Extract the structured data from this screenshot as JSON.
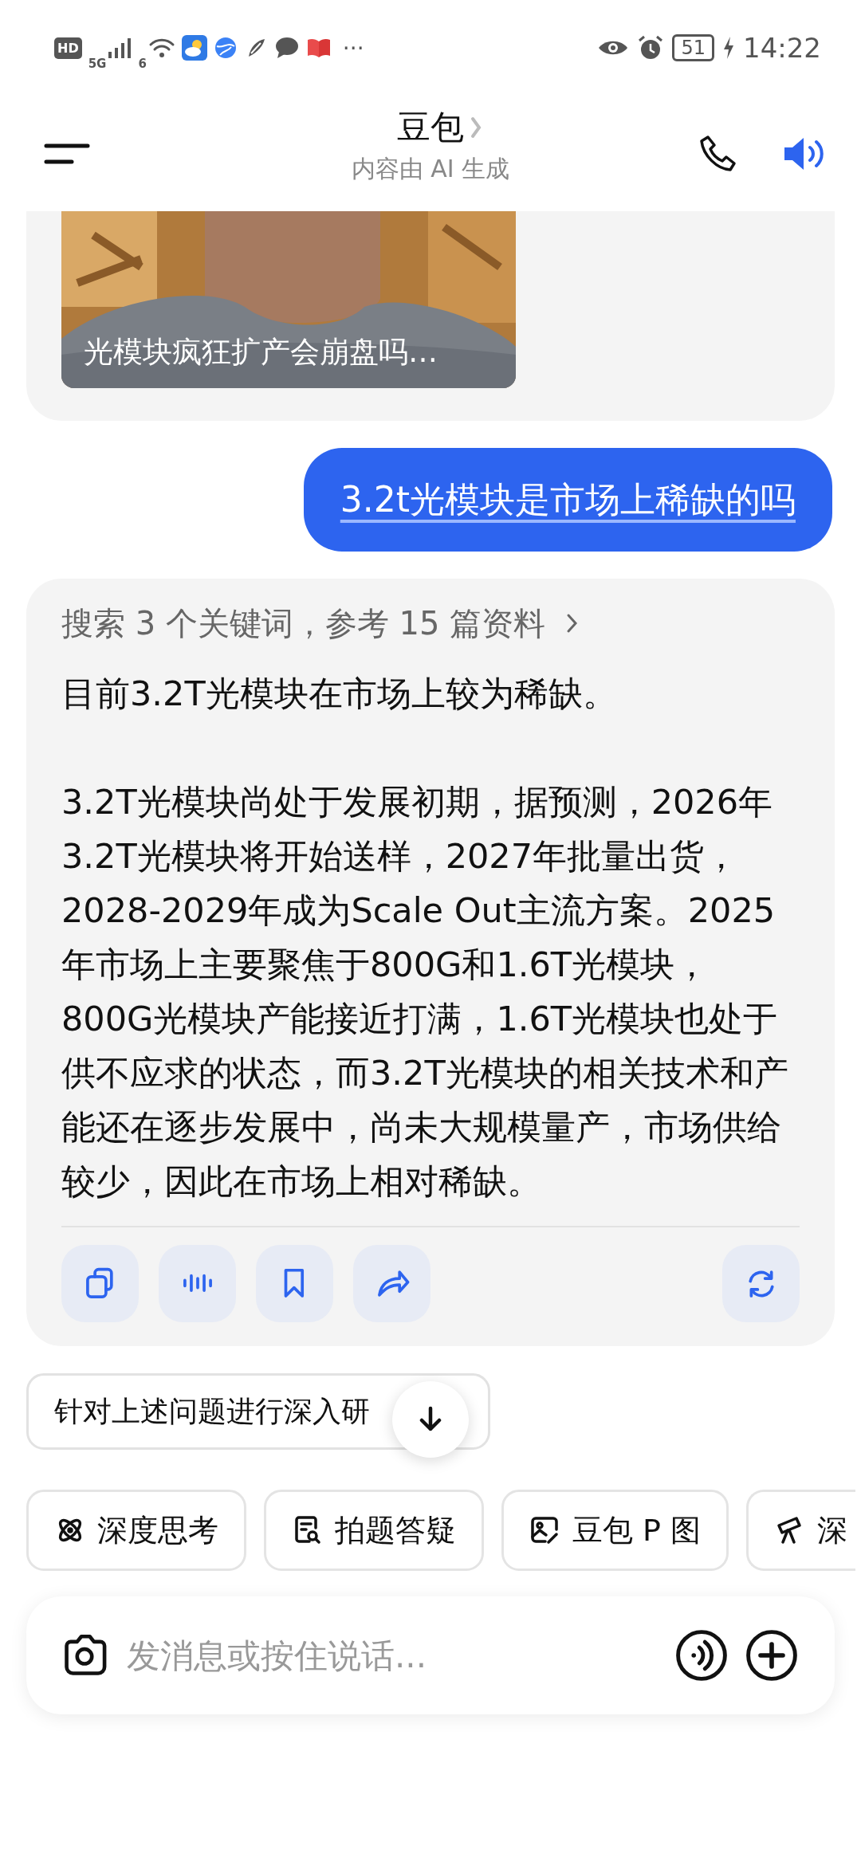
{
  "status_bar": {
    "hd": "HD",
    "network": "5G",
    "wifi": "6",
    "more": "···",
    "battery": "51",
    "time": "14:22"
  },
  "header": {
    "title": "豆包",
    "subtitle": "内容由 AI 生成"
  },
  "messages": [
    {
      "kind": "video_card",
      "caption": "光模块疯狂扩产会崩盘吗…"
    },
    {
      "kind": "user",
      "text": "3.2t光模块是市场上稀缺的吗"
    },
    {
      "kind": "answer",
      "search_summary": "搜索 3 个关键词，参考 15 篇资料",
      "paragraphs": [
        "目前3.2T光模块在市场上较为稀缺。",
        "3.2T光模块尚处于发展初期，据预测，2026年3.2T光模块将开始送样，2027年批量出货，2028-2029年成为Scale Out主流方案。2025年市场上主要聚焦于800G和1.6T光模块，800G光模块产能接近打满，1.6T光模块也处于供不应求的状态，而3.2T光模块的相关技术和产能还在逐步发展中，尚未大规模量产，市场供给较少，因此在市场上相对稀缺。"
      ]
    }
  ],
  "suggestion": "针对上述问题进行深入研",
  "tools": [
    {
      "kind": "think",
      "label": "深度思考"
    },
    {
      "kind": "photo_question",
      "label": "拍题答疑"
    },
    {
      "kind": "image_edit",
      "label": "豆包 P 图"
    },
    {
      "kind": "research",
      "label": "深"
    }
  ],
  "input": {
    "placeholder": "发消息或按住说话..."
  }
}
